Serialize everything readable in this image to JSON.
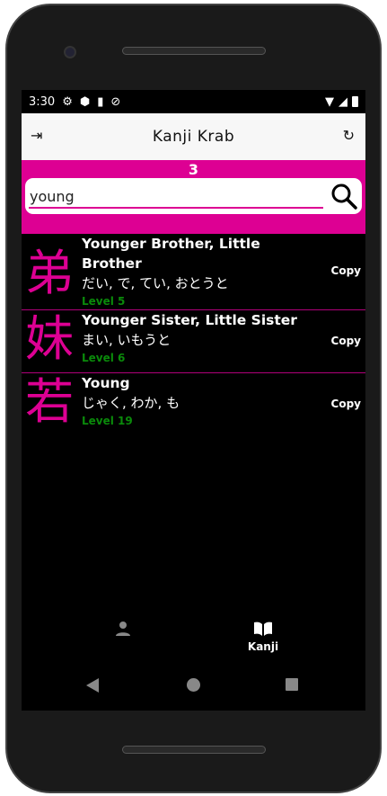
{
  "status": {
    "time": "3:30",
    "icons": [
      "gear-icon",
      "shield-play-icon",
      "sd-card-icon",
      "no-sync-icon"
    ],
    "right_icons": [
      "wifi-icon",
      "signal-icon",
      "battery-icon"
    ]
  },
  "appbar": {
    "title": "Kanji Krab",
    "left_icon": "logout-icon",
    "right_icon": "refresh-icon"
  },
  "results": {
    "count": "3"
  },
  "search": {
    "value": "young",
    "icon": "search-icon"
  },
  "colors": {
    "accent": "#dd0093",
    "level": "#0a8a0a",
    "appbar": "#f7f7f7"
  },
  "items": [
    {
      "kanji": "弟",
      "meaning": "Younger Brother, Little Brother",
      "readings": "だい, で, てい, おとうと",
      "level": "Level 5",
      "copy": "Copy"
    },
    {
      "kanji": "妹",
      "meaning": "Younger Sister, Little Sister",
      "readings": "まい, いもうと",
      "level": "Level 6",
      "copy": "Copy"
    },
    {
      "kanji": "若",
      "meaning": "Young",
      "readings": "じゃく, わか, も",
      "level": "Level 19",
      "copy": "Copy"
    }
  ],
  "bottom_nav": {
    "items": [
      {
        "icon": "person-icon",
        "label": ""
      },
      {
        "icon": "book-icon",
        "label": "Kanji"
      }
    ]
  }
}
